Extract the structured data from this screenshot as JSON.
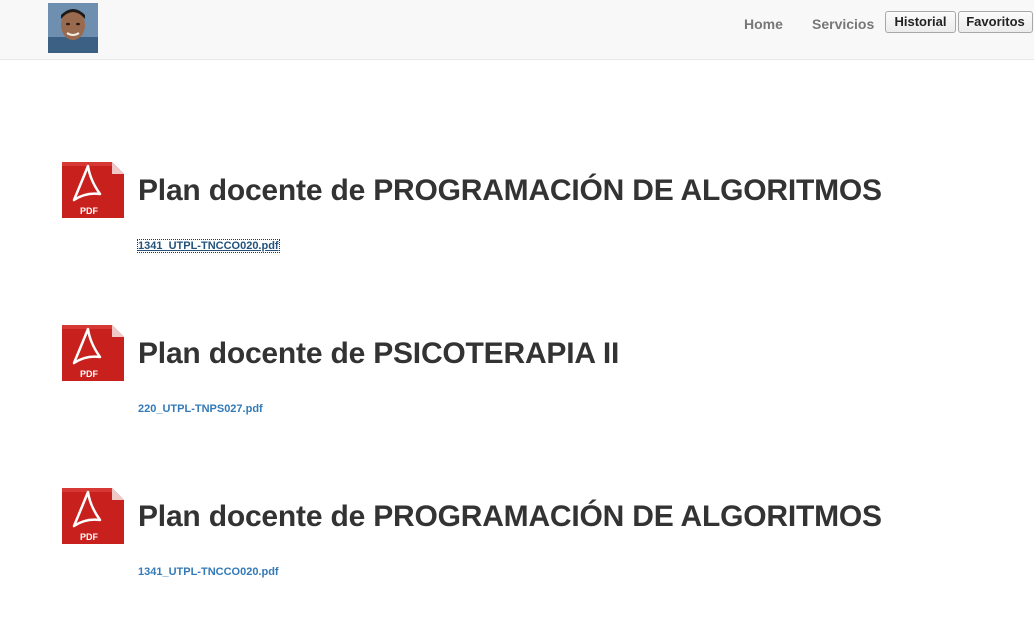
{
  "navbar": {
    "avatar_icon": "user-photo",
    "links": [
      {
        "label": "Home"
      },
      {
        "label": "Servicios"
      }
    ],
    "buttons": [
      {
        "label": "Historial"
      },
      {
        "label": "Favoritos"
      }
    ]
  },
  "documents": [
    {
      "icon": "pdf-icon",
      "icon_text": "PDF",
      "title": "Plan docente de PROGRAMACIÓN DE ALGORITMOS",
      "file": "1341_UTPL-TNCCO020.pdf"
    },
    {
      "icon": "pdf-icon",
      "icon_text": "PDF",
      "title": "Plan docente de PSICOTERAPIA II",
      "file": "220_UTPL-TNPS027.pdf"
    },
    {
      "icon": "pdf-icon",
      "icon_text": "PDF",
      "title": "Plan docente de PROGRAMACIÓN DE ALGORITMOS",
      "file": "1341_UTPL-TNCCO020.pdf"
    }
  ],
  "colors": {
    "link": "#337ab7",
    "pdf_red": "#c8201c",
    "navbar_bg": "#f8f8f8"
  }
}
